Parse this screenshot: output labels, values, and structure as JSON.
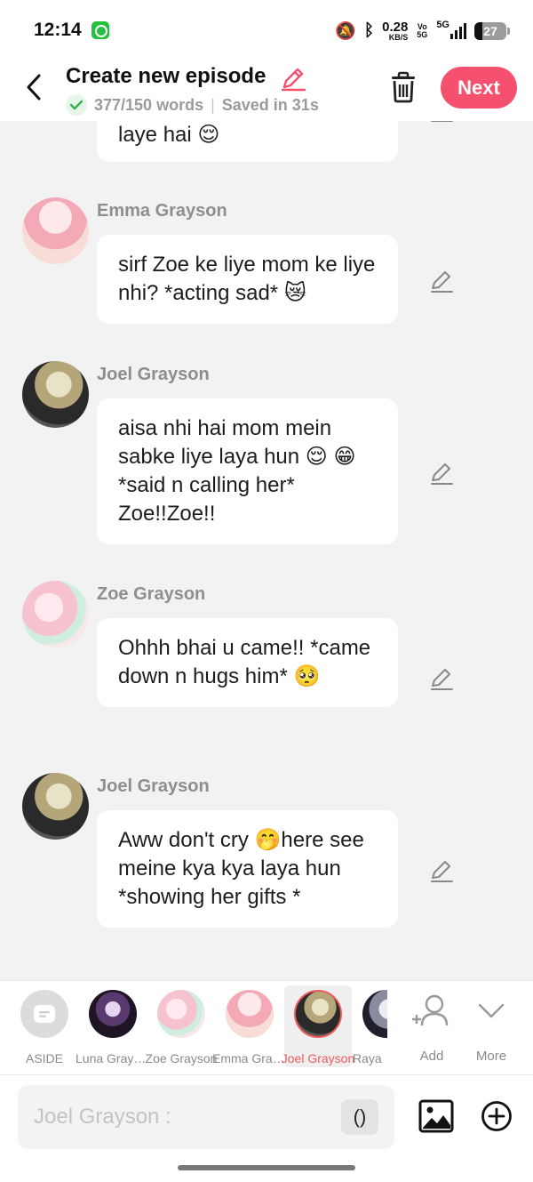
{
  "status_bar": {
    "time": "12:14",
    "speed_value": "0.28",
    "speed_unit": "KB/S",
    "volte_top": "Vo",
    "volte_bottom": "5G",
    "network": "5G",
    "battery": "27"
  },
  "header": {
    "title": "Create new episode",
    "word_count": "377/150 words",
    "separator": "|",
    "saved_status": "Saved in 31s",
    "next_label": "Next"
  },
  "messages": [
    {
      "sender": "",
      "text": "laye hai 😌"
    },
    {
      "sender": "Emma Grayson",
      "text": "sirf Zoe ke liye mom ke liye nhi? *acting sad* 😿"
    },
    {
      "sender": "Joel Grayson",
      "text": "aisa nhi hai mom mein sabke liye laya hun 😌 😁 *said n calling her* Zoe!!Zoe!!"
    },
    {
      "sender": "Zoe Grayson",
      "text": "Ohhh bhai u came!! *came down n hugs him* 🥺"
    },
    {
      "sender": "Joel Grayson",
      "text": "Aww don't cry 🤭here see meine kya kya laya hun *showing her gifts *"
    }
  ],
  "characters": [
    {
      "label": "ASIDE"
    },
    {
      "label": "Luna Grayson"
    },
    {
      "label": "Zoe Grayson"
    },
    {
      "label": "Emma Grayson"
    },
    {
      "label": "Joel Grayson",
      "selected": true
    },
    {
      "label": "Raya"
    }
  ],
  "tools": {
    "add_label": "Add",
    "more_label": "More"
  },
  "input": {
    "placeholder": "Joel Grayson :",
    "paren_label": "()"
  },
  "colors": {
    "accent": "#f5506e",
    "selected": "#f05a5a",
    "check": "#2fb34a"
  },
  "icons": [
    "back-arrow-icon",
    "pencil-icon",
    "check-icon",
    "trash-icon",
    "edit-icon",
    "aside-icon",
    "add-person-icon",
    "chevron-down-icon",
    "image-icon",
    "plus-circle-icon"
  ]
}
